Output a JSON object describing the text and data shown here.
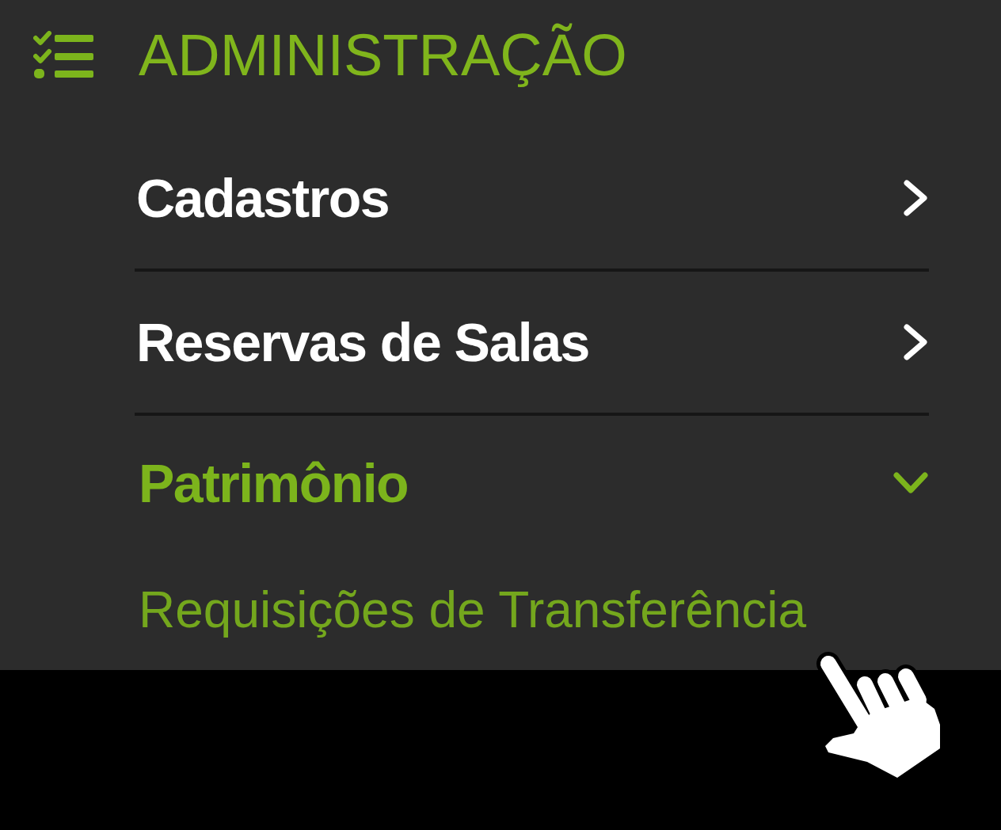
{
  "header": {
    "title": "ADMINISTRAÇÃO"
  },
  "menu": [
    {
      "label": "Cadastros",
      "expanded": false
    },
    {
      "label": "Reservas de Salas",
      "expanded": false
    },
    {
      "label": "Patrimônio",
      "expanded": true,
      "children": [
        {
          "label": "Requisições de Transferência"
        }
      ]
    }
  ]
}
